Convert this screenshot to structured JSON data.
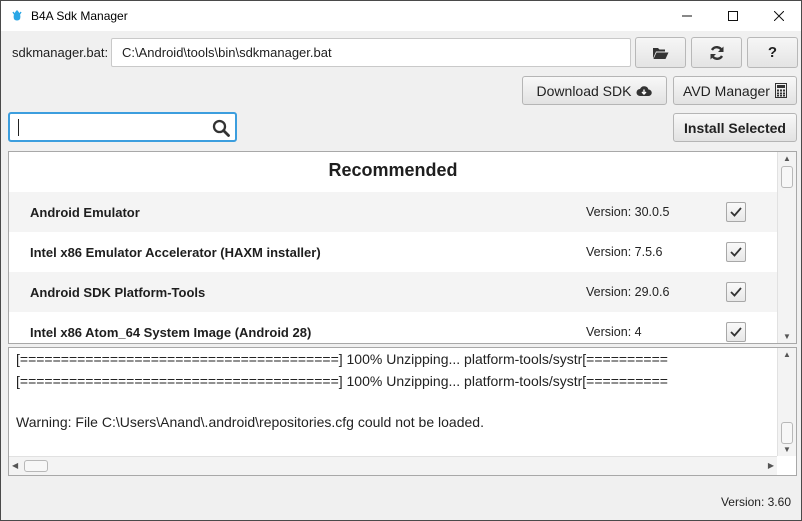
{
  "window": {
    "title": "B4A Sdk Manager",
    "minimize_label": "—",
    "maximize_label": "☐",
    "close_label": "✕"
  },
  "toolbar": {
    "path_label": "sdkmanager.bat:",
    "path_value": "C:\\Android\\tools\\bin\\sdkmanager.bat",
    "open_icon": "folder-open-icon",
    "refresh_icon": "refresh-icon",
    "help_label": "?",
    "download_label": "Download SDK",
    "avd_label": "AVD Manager",
    "install_label": "Install Selected"
  },
  "search": {
    "value": "",
    "placeholder": ""
  },
  "packages": {
    "header": "Recommended",
    "items": [
      {
        "name": "Android Emulator",
        "version": "Version: 30.0.5",
        "checked": true
      },
      {
        "name": "Intel x86 Emulator Accelerator (HAXM installer)",
        "version": "Version: 7.5.6",
        "checked": true
      },
      {
        "name": "Android SDK Platform-Tools",
        "version": "Version: 29.0.6",
        "checked": true
      },
      {
        "name": "Intel x86 Atom_64 System Image (Android 28)",
        "version": "Version: 4",
        "checked": true
      }
    ]
  },
  "log": {
    "lines": [
      "[=======================================] 100% Unzipping... platform-tools/systr[==========",
      "[=======================================] 100% Unzipping... platform-tools/systr[==========",
      "",
      "Warning: File C:\\Users\\Anand\\.android\\repositories.cfg could not be loaded."
    ]
  },
  "footer": {
    "version": "Version: 3.60"
  },
  "colors": {
    "accent": "#3c9ede",
    "app_icon": "#2aa7e6"
  }
}
